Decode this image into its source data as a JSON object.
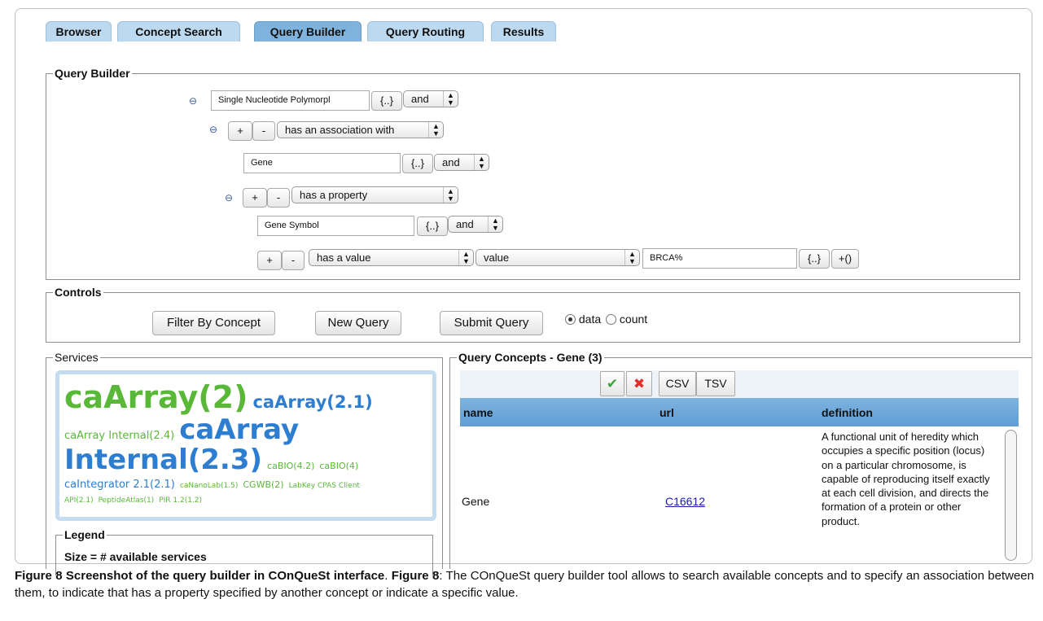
{
  "tabs": [
    {
      "label": "Browser",
      "active": false
    },
    {
      "label": "Concept Search",
      "active": false
    },
    {
      "label": "Query Builder",
      "active": true
    },
    {
      "label": "Query Routing",
      "active": false
    },
    {
      "label": "Results",
      "active": false
    }
  ],
  "query_builder": {
    "title": "Query Builder",
    "concept_value": "Single Nucleotide Polymorpl",
    "concept_browse": "{..}",
    "concept_op": "and",
    "assoc_relation": "has an association with",
    "gene_value": "Gene",
    "gene_browse": "{..}",
    "gene_op": "and",
    "property_relation": "has a property",
    "symbol_value": "Gene Symbol",
    "symbol_browse": "{..}",
    "symbol_op": "and",
    "value_relation": "has a value",
    "value_type": "value",
    "value_text": "BRCA%",
    "value_browse": "{..}",
    "value_add": "+()",
    "plus": "+",
    "minus": "-",
    "collapse": "⊖"
  },
  "controls": {
    "title": "Controls",
    "filter_label": "Filter By Concept",
    "new_label": "New Query",
    "submit_label": "Submit Query",
    "radio_data": "data",
    "radio_count": "count",
    "selected": "data"
  },
  "services": {
    "title": "Services",
    "tags": [
      {
        "text": "caArray(2)",
        "size": 38,
        "color": "green"
      },
      {
        "text": "caArray(2.1)",
        "size": 22,
        "color": "blue"
      },
      {
        "text": "caArray Internal(2.4)",
        "size": 13,
        "color": "green"
      },
      {
        "text": "caArray Internal(2.3)",
        "size": 34,
        "color": "blue"
      },
      {
        "text": "caBIO(4.2)",
        "size": 11,
        "color": "green"
      },
      {
        "text": "caBIO(4)",
        "size": 11,
        "color": "green"
      },
      {
        "text": "caIntegrator 2.1(2.1)",
        "size": 13,
        "color": "blue"
      },
      {
        "text": "caNanoLab(1.5)",
        "size": 9,
        "color": "green"
      },
      {
        "text": "CGWB(2)",
        "size": 11,
        "color": "green"
      },
      {
        "text": "LabKey CPAS Client API(2.1)",
        "size": 9,
        "color": "green"
      },
      {
        "text": "PeptideAtlas(1)",
        "size": 9,
        "color": "green"
      },
      {
        "text": "PIR 1.2(1.2)",
        "size": 9,
        "color": "green"
      }
    ],
    "legend_title": "Legend",
    "legend_text": "Size = # available services"
  },
  "concepts": {
    "title": "Query Concepts - Gene (3)",
    "csv_label": "CSV",
    "tsv_label": "TSV",
    "check_glyph": "✔",
    "cross_glyph": "✖",
    "columns": [
      "name",
      "url",
      "definition"
    ],
    "rows": [
      {
        "name": "Gene",
        "url": "C16612",
        "definition": "A functional unit of heredity which occupies a specific position (locus) on a particular chromosome, is capable of reproducing itself exactly at each cell division, and directs the formation of a protein or other product."
      }
    ]
  },
  "caption": {
    "head": "Figure 8 Screenshot of the query builder in COnQueSt interface",
    "label": "Figure 8",
    "text": ": The COnQueSt query builder tool allows to search available concepts and to specify an association between them, to indicate that has a property specified by another concept or indicate a specific value."
  }
}
